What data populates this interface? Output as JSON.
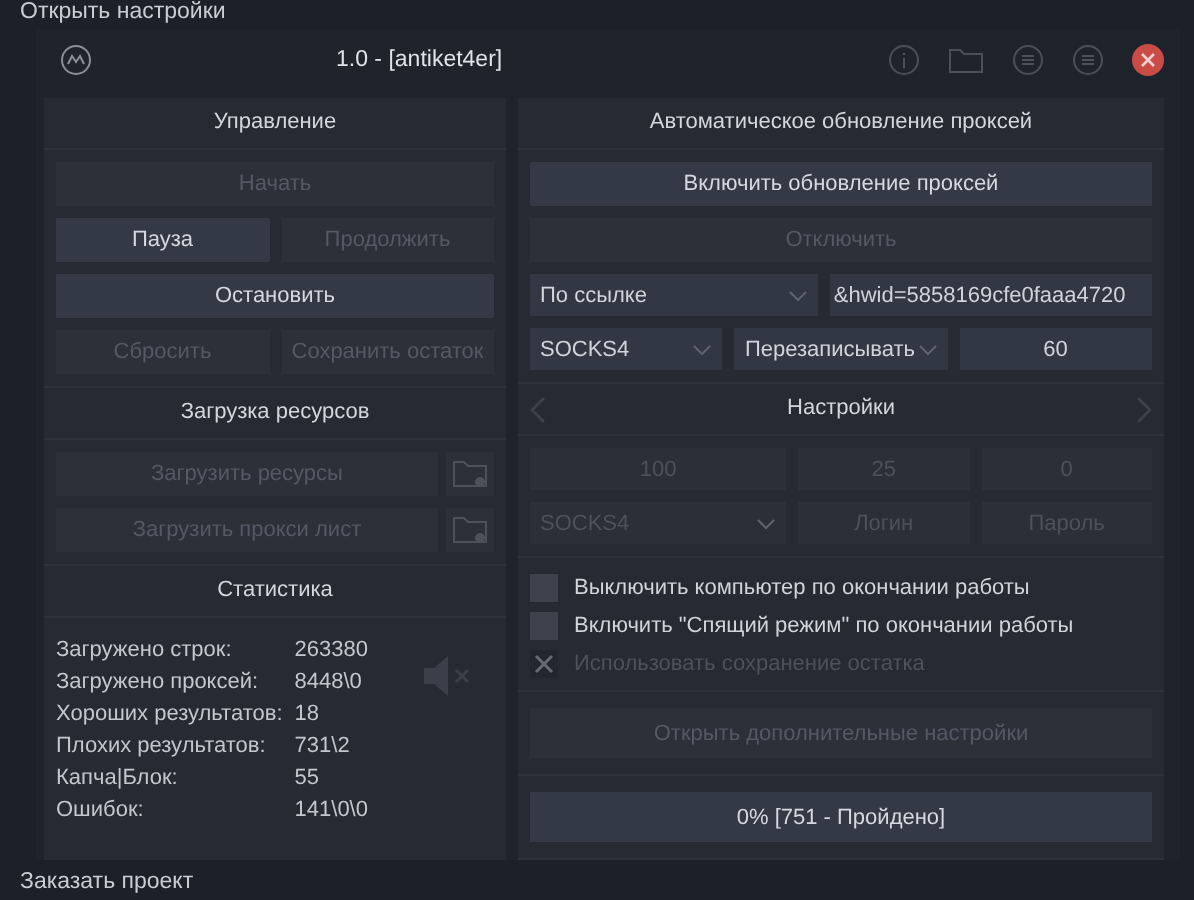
{
  "background_app": {
    "top_link": "Открыть настройки",
    "bottom_link": "Заказать проект"
  },
  "window": {
    "title": "1.0 - [antiket4er]"
  },
  "control": {
    "header": "Управление",
    "rows": [
      [
        {
          "label": "Начать",
          "disabled": true
        }
      ],
      [
        {
          "label": "Пауза",
          "disabled": false
        },
        {
          "label": "Продолжить",
          "disabled": true
        }
      ],
      [
        {
          "label": "Остановить",
          "disabled": false
        }
      ],
      [
        {
          "label": "Сбросить",
          "disabled": true
        },
        {
          "label": "Сохранить остаток",
          "disabled": true
        }
      ]
    ]
  },
  "resources": {
    "header": "Загрузка ресурсов",
    "items": [
      {
        "label": "Загрузить ресурсы",
        "disabled": true
      },
      {
        "label": "Загрузить прокси лист",
        "disabled": true
      }
    ]
  },
  "statistics": {
    "header": "Статистика",
    "muted": true,
    "rows": [
      {
        "label": "Загружено строк:",
        "value": "263380"
      },
      {
        "label": "Загружено проксей:",
        "value": "8448\\0"
      },
      {
        "label": "Хороших результатов:",
        "value": "18"
      },
      {
        "label": "Плохих результатов:",
        "value": "731\\2"
      },
      {
        "label": "Капча|Блок:",
        "value": "55"
      },
      {
        "label": "Ошибок:",
        "value": "141\\0\\0"
      }
    ]
  },
  "proxy_update": {
    "header": "Автоматическое обновление проксей",
    "buttons": [
      {
        "label": "Включить обновление проксей",
        "disabled": false
      },
      {
        "label": "Отключить",
        "disabled": true
      }
    ],
    "rows": [
      [
        {
          "kind": "select",
          "value": "По ссылке",
          "disabled": false
        },
        {
          "kind": "input",
          "value": "&hwid=5858169cfe0faaa4720",
          "disabled": false
        }
      ],
      [
        {
          "kind": "select",
          "value": "SOCKS4",
          "disabled": false
        },
        {
          "kind": "select",
          "value": "Перезаписывать",
          "disabled": false
        },
        {
          "kind": "input",
          "value": "60",
          "disabled": false
        }
      ]
    ]
  },
  "settings": {
    "header": "Настройки",
    "rows": [
      [
        {
          "kind": "input",
          "value": "100",
          "disabled": true
        },
        {
          "kind": "input",
          "value": "25",
          "disabled": true
        },
        {
          "kind": "input",
          "value": "0",
          "disabled": true
        }
      ],
      [
        {
          "kind": "select",
          "value": "SOCKS4",
          "disabled": true
        },
        {
          "kind": "input",
          "placeholder": "Логин",
          "disabled": true
        },
        {
          "kind": "input",
          "placeholder": "Пароль",
          "disabled": true
        }
      ]
    ],
    "checkboxes": [
      {
        "label": "Выключить компьютер по окончании работы",
        "checked": false,
        "disabled": false
      },
      {
        "label": "Включить \"Спящий режим\" по окончании работы",
        "checked": false,
        "disabled": false
      },
      {
        "label": "Использовать сохранение остатка",
        "checked": true,
        "disabled": true
      }
    ],
    "more_button": {
      "label": "Открыть дополнительные настройки",
      "disabled": true
    },
    "progress": {
      "text": "0% [751 - Пройдено]",
      "level": 0
    }
  }
}
